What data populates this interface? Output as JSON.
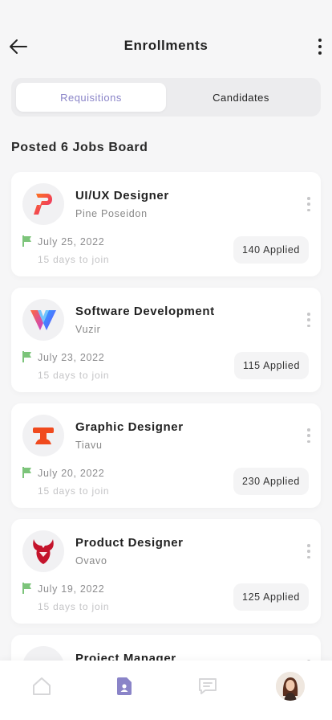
{
  "header": {
    "title": "Enrollments"
  },
  "tabs": [
    {
      "label": "Requisitions",
      "active": true
    },
    {
      "label": "Candidates",
      "active": false
    }
  ],
  "section_title": "Posted 6 Jobs Board",
  "jobs": [
    {
      "title": "UI/UX Designer",
      "company": "Pine Poseidon",
      "date": "July 25, 2022",
      "join": "15 days to join",
      "applied": "140 Applied",
      "logo": "pine-poseidon-logo"
    },
    {
      "title": "Software Development",
      "company": "Vuzir",
      "date": "July 23, 2022",
      "join": "15 days to join",
      "applied": "115 Applied",
      "logo": "vuzir-logo"
    },
    {
      "title": "Graphic Designer",
      "company": "Tiavu",
      "date": "July 20, 2022",
      "join": "15 days to join",
      "applied": "230 Applied",
      "logo": "tiavu-logo"
    },
    {
      "title": "Product Designer",
      "company": "Ovavo",
      "date": "July 19, 2022",
      "join": "15 days to join",
      "applied": "125 Applied",
      "logo": "ovavo-logo"
    },
    {
      "title": "Project Manager",
      "company": "",
      "date": "",
      "join": "",
      "applied": "",
      "logo": "project-logo"
    }
  ],
  "colors": {
    "accent": "#8a84c8",
    "flag": "#7cc47a",
    "background": "#f6f6f7"
  },
  "bottom_nav": [
    {
      "icon": "home-icon",
      "active": false
    },
    {
      "icon": "jobs-icon",
      "active": true
    },
    {
      "icon": "chat-icon",
      "active": false
    },
    {
      "icon": "profile-avatar",
      "active": false
    }
  ]
}
